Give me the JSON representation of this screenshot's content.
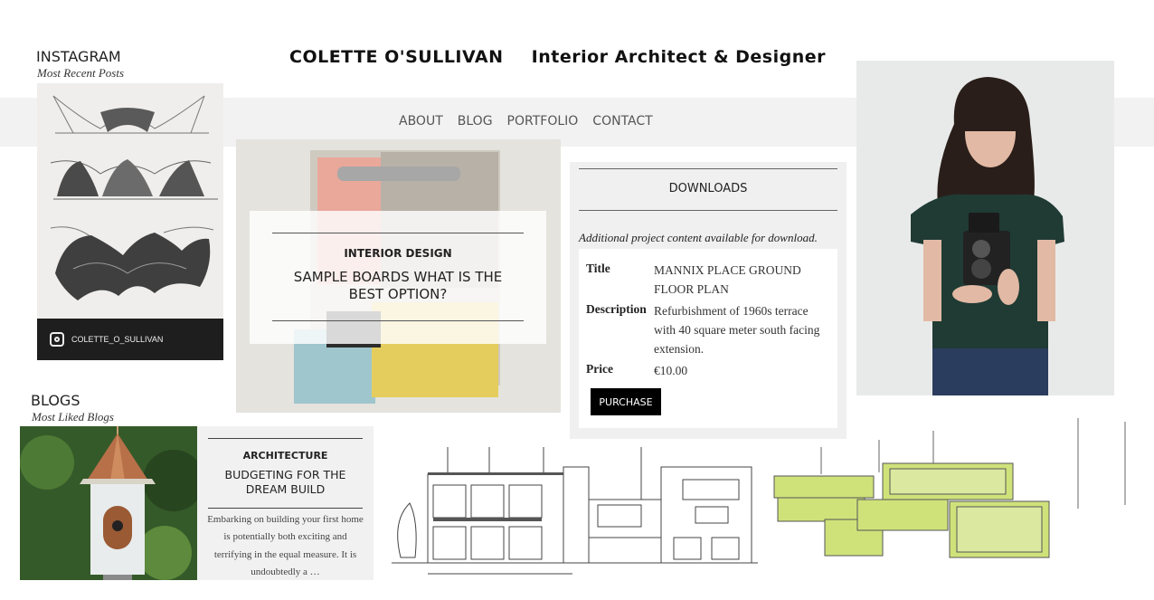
{
  "header": {
    "name": "COLETTE O'SULLIVAN",
    "tagline": "Interior Architect & Designer"
  },
  "nav": {
    "items": [
      "ABOUT",
      "BLOG",
      "PORTFOLIO",
      "CONTACT"
    ]
  },
  "instagram": {
    "title": "INSTAGRAM",
    "subtitle": "Most Recent Posts",
    "handle": "COLETTE_O_SULLIVAN",
    "icon": "instagram-icon"
  },
  "feature": {
    "category": "INTERIOR DESIGN",
    "title": "SAMPLE BOARDS WHAT IS THE BEST OPTION?"
  },
  "downloads": {
    "title": "DOWNLOADS",
    "intro": "Additional project content available for download.",
    "title_label": "Title",
    "title_value": "MANNIX PLACE GROUND FLOOR PLAN",
    "description_label": "Description",
    "description_value": "Refurbishment of 1960s terrace with 40 square meter south facing extension.",
    "price_label": "Price",
    "price_value": "€10.00",
    "button_label": "PURCHASE"
  },
  "blogs": {
    "title": "BLOGS",
    "subtitle": "Most Liked Blogs",
    "post": {
      "category": "ARCHITECTURE",
      "title": "BUDGETING FOR THE DREAM BUILD",
      "excerpt": "Embarking on building your first home is potentially both exciting and terrifying in the equal measure. It is undoubtedly a …"
    }
  },
  "colors": {
    "nav_background": "#f2f2f2",
    "button": "#000000",
    "instagram_footer": "#1e1e1e",
    "module_green": "#cfe27a"
  }
}
